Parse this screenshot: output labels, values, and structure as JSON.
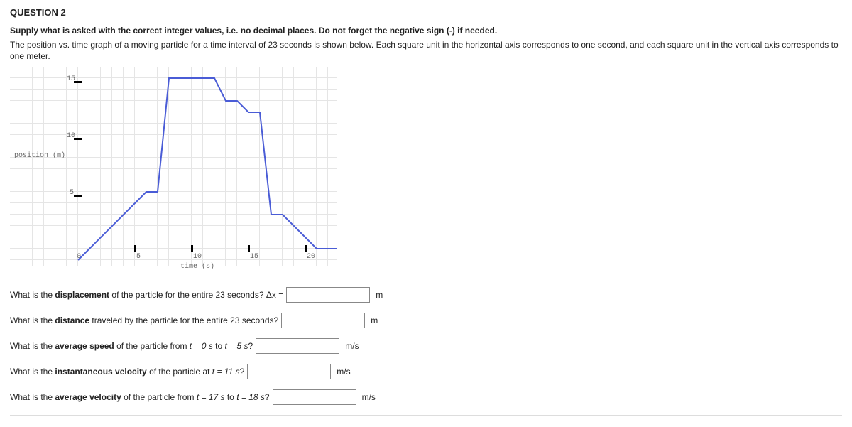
{
  "question_number": "QUESTION 2",
  "instruction_bold": "Supply what is asked with the correct integer values, i.e. no decimal places. Do not forget the negative sign (-) if needed.",
  "instruction_body": "The position vs. time graph of a moving particle for a time interval of 23 seconds is shown below. Each square unit in the horizontal axis corresponds to one second, and each square unit in the vertical axis corresponds to one meter.",
  "chart_data": {
    "type": "line",
    "xlabel": "time (s)",
    "ylabel": "position (m)",
    "x_ticks": [
      0,
      5,
      10,
      15,
      20
    ],
    "y_ticks": [
      5,
      10,
      15
    ],
    "xlim": [
      -6,
      23
    ],
    "ylim": [
      0,
      17
    ],
    "series": [
      {
        "name": "position",
        "x": [
          0,
          1,
          6,
          7,
          8,
          9,
          12,
          13,
          14,
          15,
          16,
          17,
          18,
          21,
          23
        ],
        "y": [
          -1,
          0,
          5,
          5,
          15,
          15,
          15,
          13,
          13,
          12,
          12,
          3,
          3,
          0,
          0
        ]
      }
    ]
  },
  "q1_prefix": "What is the ",
  "q1_bold": "displacement",
  "q1_suffix": " of the particle for the entire 23 seconds? Δx =",
  "q1_unit": "m",
  "q2_prefix": "What is the ",
  "q2_bold": "distance",
  "q2_suffix": " traveled by the particle for the entire 23 seconds?",
  "q2_unit": "m",
  "q3_prefix": "What is the ",
  "q3_bold": "average speed",
  "q3_suffix_a": " of the particle from ",
  "q3_suffix_b": "t = 0 s",
  "q3_suffix_c": " to ",
  "q3_suffix_d": "t = 5 s",
  "q3_suffix_e": "?",
  "q3_unit": "m/s",
  "q4_prefix": "What is the ",
  "q4_bold": "instantaneous velocity",
  "q4_suffix_a": " of the particle at ",
  "q4_suffix_b": "t = 11 s",
  "q4_suffix_c": "?",
  "q4_unit": "m/s",
  "q5_prefix": "What is the ",
  "q5_bold": "average velocity",
  "q5_suffix_a": " of the particle from ",
  "q5_suffix_b": "t = 17 s",
  "q5_suffix_c": " to ",
  "q5_suffix_d": "t = 18 s",
  "q5_suffix_e": "?",
  "q5_unit": "m/s"
}
